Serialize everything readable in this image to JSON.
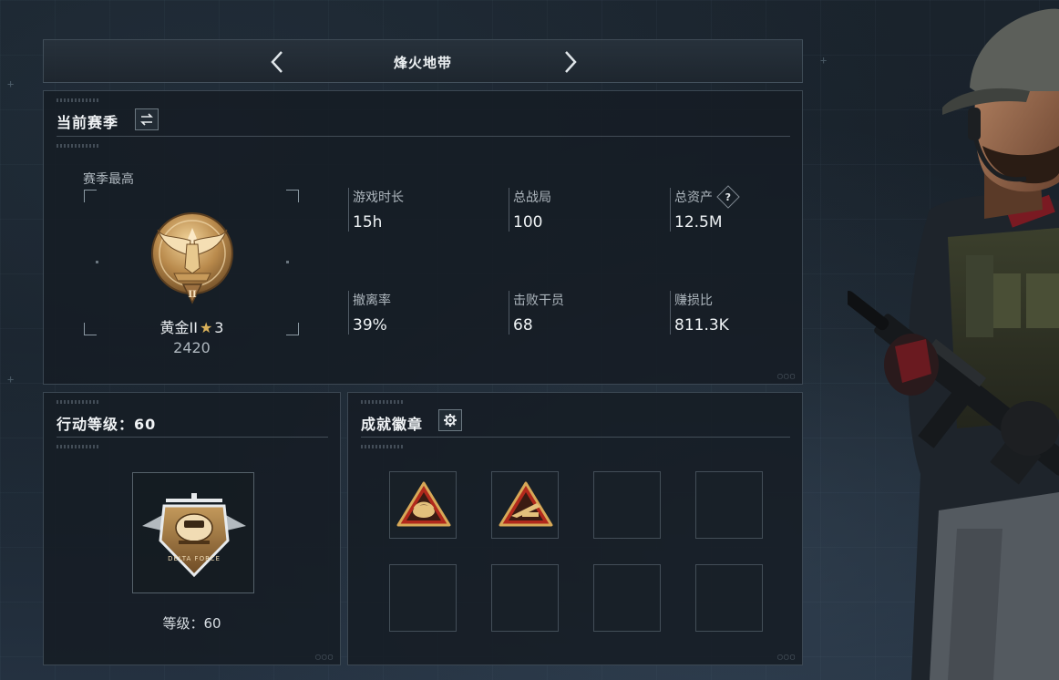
{
  "header": {
    "title": "烽火地带"
  },
  "season": {
    "title": "当前赛季",
    "peak_label": "赛季最高",
    "rank": {
      "name": "黄金II",
      "star_icon": "star-icon",
      "stars": "3",
      "score": "2420"
    },
    "stats": [
      {
        "label": "游戏时长",
        "value": "15h"
      },
      {
        "label": "总战局",
        "value": "100"
      },
      {
        "label": "总资产",
        "value": "12.5M",
        "help": "?"
      },
      {
        "label": "撤离率",
        "value": "39%"
      },
      {
        "label": "击败干员",
        "value": "68"
      },
      {
        "label": "赚损比",
        "value": "811.3K"
      }
    ]
  },
  "action": {
    "title": "行动等级：60",
    "level_text": "等级：60"
  },
  "achievements": {
    "title": "成就徽章",
    "slots": [
      {
        "icon": "achievement-hand-triangle-icon",
        "filled": true
      },
      {
        "icon": "achievement-weapon-triangle-icon",
        "filled": true
      },
      {
        "filled": false
      },
      {
        "filled": false
      },
      {
        "filled": false
      },
      {
        "filled": false
      },
      {
        "filled": false
      },
      {
        "filled": false
      }
    ]
  },
  "colors": {
    "accent_gold": "#d9b15a",
    "panel_bg": "#161d24",
    "text_primary": "#eef2f4",
    "text_secondary": "#aeb7be"
  }
}
